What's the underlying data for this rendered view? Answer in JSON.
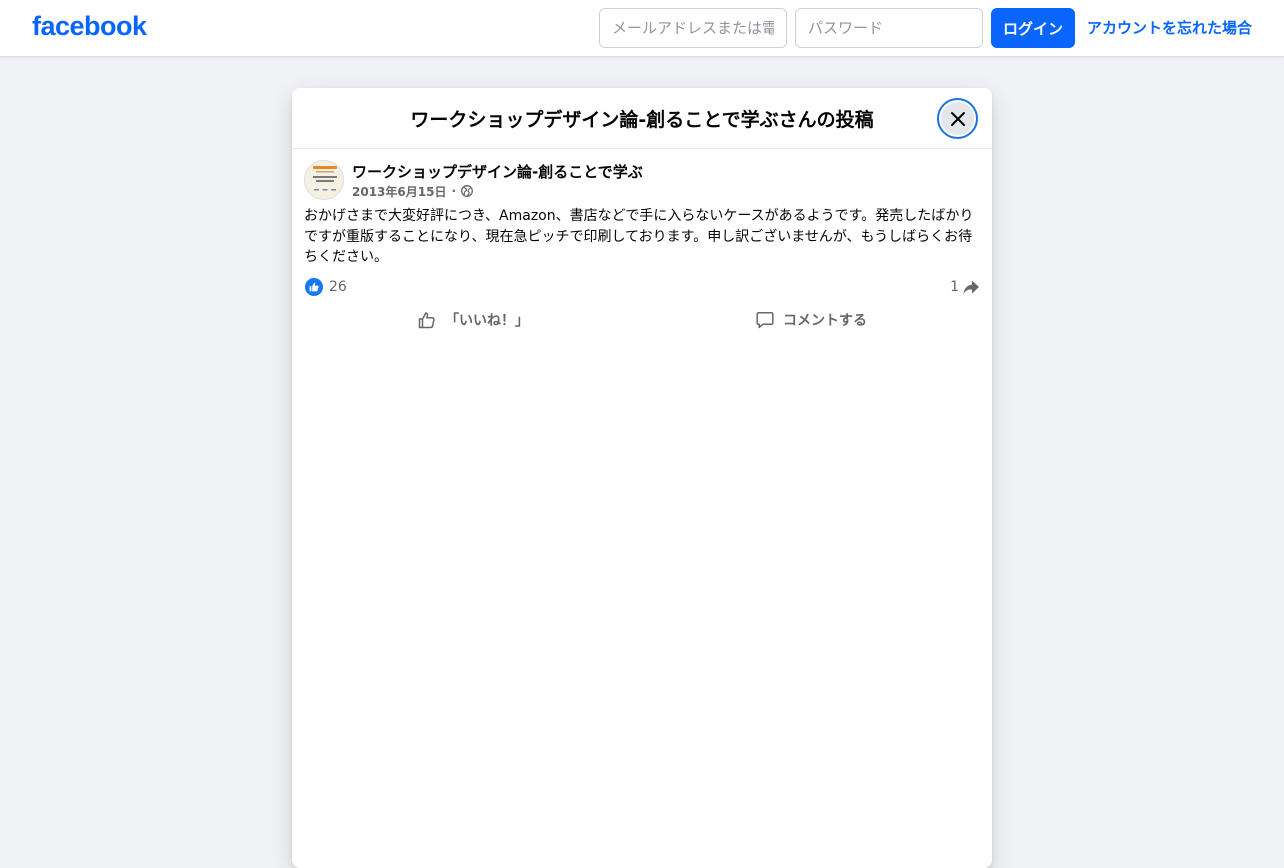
{
  "header": {
    "logo": "facebook",
    "email_placeholder": "メールアドレスまたは電話番号",
    "password_placeholder": "パスワード",
    "login_label": "ログイン",
    "forgot_label": "アカウントを忘れた場合"
  },
  "modal": {
    "title": "ワークショップデザイン論-創ることで学ぶさんの投稿"
  },
  "post": {
    "author": "ワークショップデザイン論-創ることで学ぶ",
    "date": "2013年6月15日",
    "separator": "·",
    "privacy_icon": "globe-icon",
    "text": "おかげさまで大変好評につき、Amazon、書店などで手に入らないケースがあるようです。発売したばかりですが重版することになり、現在急ピッチで印刷しております。申し訳ございませんが、もうしばらくお待ちください。",
    "like_count": "26",
    "share_count": "1",
    "like_label": "「いいね！」",
    "comment_label": "コメントする"
  },
  "colors": {
    "brand": "#0866ff",
    "page_bg": "#f0f2f5",
    "secondary_text": "#65676b"
  }
}
